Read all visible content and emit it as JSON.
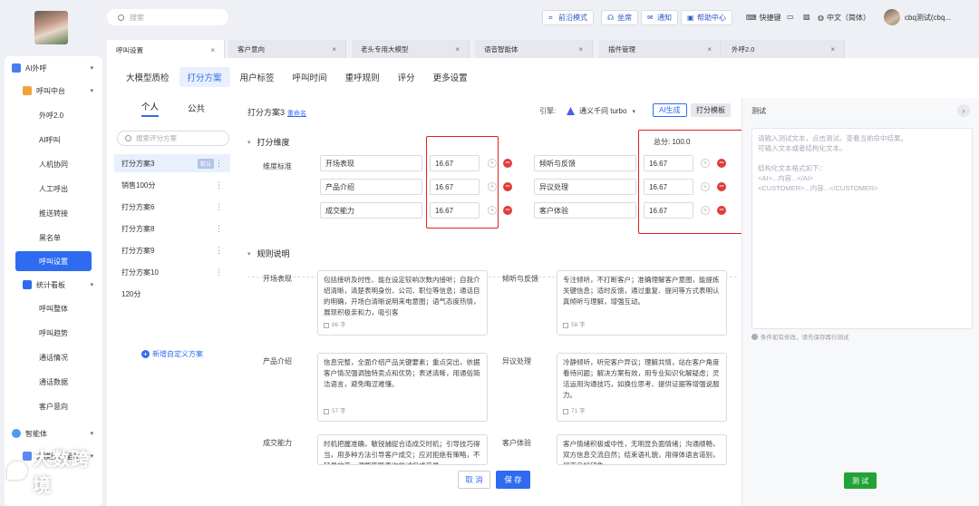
{
  "sidebar": {
    "groups": [
      {
        "label": "AI外呼"
      },
      {
        "label": "呼叫中台"
      }
    ],
    "items": [
      {
        "label": "外呼2.0"
      },
      {
        "label": "AI呼叫"
      },
      {
        "label": "人机协同"
      },
      {
        "label": "人工呼出"
      },
      {
        "label": "推送转接"
      },
      {
        "label": "黑名单"
      },
      {
        "label": "呼叫设置"
      }
    ],
    "group2": {
      "label": "统计看板"
    },
    "stat_items": [
      {
        "label": "呼叫整体"
      },
      {
        "label": "呼叫趋势"
      },
      {
        "label": "通话情况"
      },
      {
        "label": "通话数据"
      },
      {
        "label": "客户意向"
      }
    ],
    "group3": {
      "label": "智能体"
    },
    "group4": {
      "label": "大模型智能体"
    },
    "brand": "大数跨境"
  },
  "topbar": {
    "search_placeholder": "搜索",
    "btn_frontier": "前沿模式",
    "btn_seat": "坐席",
    "btn_notice": "通知",
    "btn_help": "帮助中心",
    "link_shortcut": "快捷键",
    "language": "中文（简体）",
    "username": "cbq测试(cbq..."
  },
  "tabs": [
    {
      "label": "呼叫设置"
    },
    {
      "label": "客户意向"
    },
    {
      "label": "老头专用大模型"
    },
    {
      "label": "语音智能体"
    },
    {
      "label": "插件管理"
    },
    {
      "label": "外呼2.0"
    }
  ],
  "subtabs": [
    "大模型质检",
    "打分方案",
    "用户标签",
    "呼叫时间",
    "重呼规则",
    "评分",
    "更多设置"
  ],
  "schemes": {
    "tab_personal": "个人",
    "tab_public": "公共",
    "search_placeholder": "搜索评分方案",
    "items": [
      {
        "label": "打分方案3",
        "badge": "默认"
      },
      {
        "label": "销售100分"
      },
      {
        "label": "打分方案6"
      },
      {
        "label": "打分方案8"
      },
      {
        "label": "打分方案9"
      },
      {
        "label": "打分方案10"
      },
      {
        "label": "120分"
      }
    ],
    "add_label": "新增自定义方案"
  },
  "editor": {
    "title": "打分方案3",
    "rename": "重命名",
    "engine_label": "引擎:",
    "engine_value": "通义千问 turbo",
    "btn_ai": "AI生成",
    "btn_template": "打分模板",
    "section_dim": "打分维度",
    "total": "总分: 100.0",
    "dim_label": "维度标准",
    "dims_left": [
      {
        "name": "开场表现",
        "score": "16.67"
      },
      {
        "name": "产品介绍",
        "score": "16.67"
      },
      {
        "name": "成交能力",
        "score": "16.67"
      }
    ],
    "dims_right": [
      {
        "name": "倾听与反馈",
        "score": "16.67"
      },
      {
        "name": "异议处理",
        "score": "16.67"
      },
      {
        "name": "客户体验",
        "score": "16.67"
      }
    ],
    "section_rules": "规则说明",
    "rules": [
      {
        "label": "开场表现",
        "text": "包括接听及时性、能在设定较响次数内接听；自我介绍清晰，清楚表明身份、公司、职位等信息；通话目的明确，开场白清晰说明来电意图；语气态度热情，展现积极亲和力，吸引客",
        "count": "86 字"
      },
      {
        "label": "倾听与反馈",
        "text": "专注倾听，不打断客户；准确理解客户意图，能提炼关键信息；适时反馈，通过重复、提问等方式表明认真倾听与理解，增强互动。",
        "count": "58 字"
      },
      {
        "label": "产品介绍",
        "text": "信息完整，全面介绍产品关键要素；重点突出，依据客户情况强调独特卖点和优势；表述清晰，用通俗简洁语言，避免晦涩难懂。",
        "count": "57 字"
      },
      {
        "label": "异议处理",
        "text": "冷静倾听，听完客户异议；理解共情，站在客户角度看待问题；解决方案有效，用专业知识化解疑虑；灵活运用沟通技巧，如换位思考、提供证据等增强说服力。",
        "count": "71 字"
      },
      {
        "label": "成交能力",
        "text": "时机把握准确，敏锐捕捉合适成交时机；引导技巧得当，用多种方法引导客户成交；应对拒绝有策略，不轻易放弃，调整策略再次尝试促成交易。",
        "count": ""
      },
      {
        "label": "客户体验",
        "text": "客户情绪积极或中性，无明显负面情绪；沟通顺畅，双方信息交流自然；结束语礼貌，用得体语言道别，留下良好印象。",
        "count": ""
      }
    ],
    "btn_cancel": "取 消",
    "btn_save": "保 存"
  },
  "test": {
    "title": "测试",
    "placeholder_lines": [
      "请输入测试文本，点击测试，查看当前命中结果。",
      "可输入文本或者结构化文本。",
      "",
      "结构化文本格式如下：",
      "<AI>...内容...</AI>",
      "<CUSTOMER>...内容...</CUSTOMER>"
    ],
    "note": "条件如有修改，请先保存再行测试",
    "btn_test": "测 试"
  },
  "colors": {
    "accent": "#2f6bf0",
    "danger": "#e23b3b",
    "highlight": "#e02020",
    "test_button": "#21a336"
  }
}
